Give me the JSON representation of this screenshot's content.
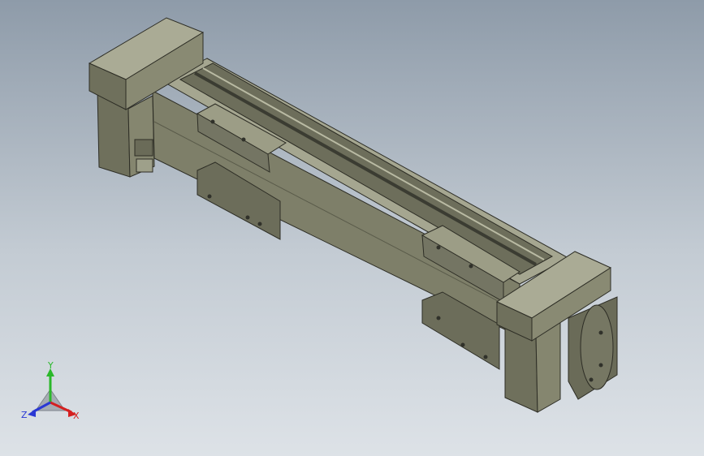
{
  "viewport": {
    "background_top": "#8e9ba9",
    "background_bottom": "#dde2e7",
    "model_color": "#7b7c66"
  },
  "triad": {
    "x_label": "X",
    "y_label": "Y",
    "z_label": "Z",
    "x_color": "#d42020",
    "y_color": "#2ab82a",
    "z_color": "#2a38d4"
  }
}
